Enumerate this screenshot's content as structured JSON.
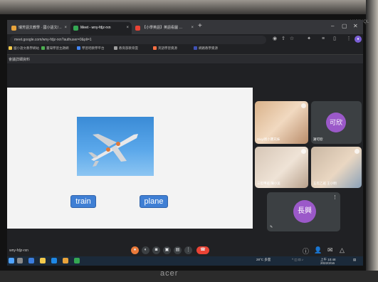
{
  "browser": {
    "tabs": [
      {
        "label": "瑞芳語文教學 · 國小語文/…",
        "active": false,
        "color": "#e8a33b"
      },
      {
        "label": "Meet - wny-fdjz-rxn",
        "active": true,
        "color": "#34a853"
      },
      {
        "label": "【小學英語】英語看圖 …",
        "active": false,
        "color": "#ea4335"
      }
    ],
    "new_tab": "+",
    "url": "meet.google.com/wny-fdjz-rxn?authuser=0&pli=1",
    "bookmarks": [
      "國小語文教學網站",
      "臺灣學習主題網",
      "學習吧教學平台",
      "教育部教育雲",
      "英語學習資源",
      "網路教學資源"
    ]
  },
  "meet": {
    "title": "會議詳細資料",
    "slide_words": [
      "train",
      "plane"
    ],
    "participants": [
      {
        "name": "Siuyi周小寶兄妹",
        "kind": "video"
      },
      {
        "name": "謝可欣",
        "kind": "avatar",
        "initials": "可欣",
        "color": "#9b59c9"
      },
      {
        "name": "三年甲班 陳小美",
        "kind": "video"
      },
      {
        "name": "五年乙班 王小明",
        "kind": "video"
      },
      {
        "name": "",
        "kind": "avatar",
        "initials": "長興",
        "color": "#9b59c9"
      }
    ],
    "meeting_code": "wny-fdjz-rxn",
    "controls": [
      "mic-icon",
      "camera-icon",
      "captions-icon",
      "present-icon",
      "more-icon",
      "hangup-icon"
    ]
  },
  "taskbar": {
    "weather": "28°C 多雲",
    "time": "上午 10:48",
    "date": "2022/3/16"
  },
  "monitor": {
    "brand": "acer",
    "model": "V196HQL"
  }
}
